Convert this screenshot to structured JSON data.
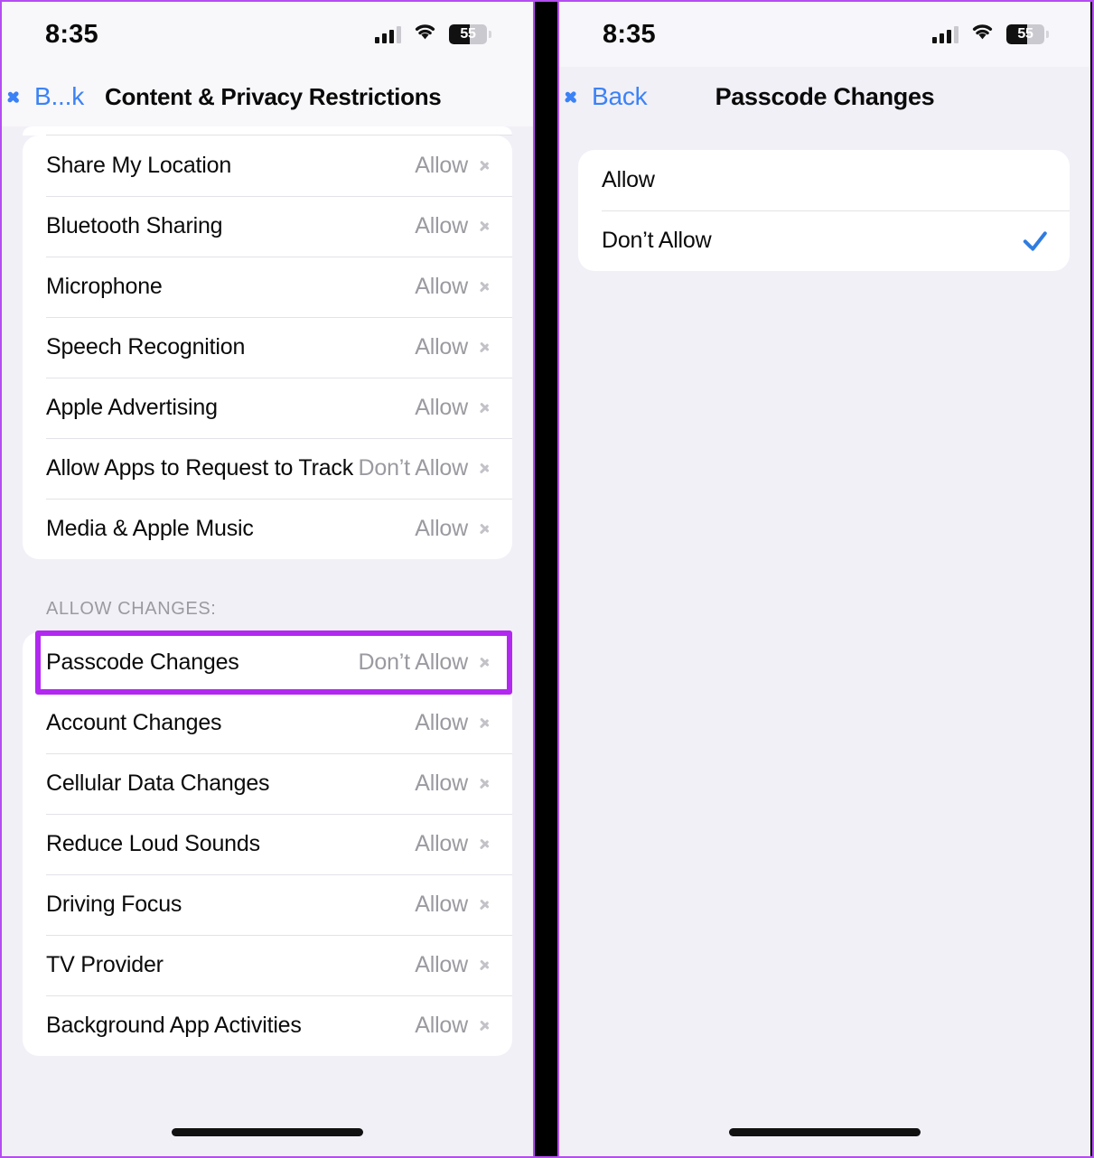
{
  "colors": {
    "accent_purple": "#b228f0",
    "ios_blue": "#3b82f6",
    "check_blue": "#2f7ce0",
    "value_gray": "#9a9aa0",
    "page_bg": "#f2f0f7",
    "card_bg": "#ffffff"
  },
  "left_panel": {
    "status_bar": {
      "time": "8:35",
      "battery_percent": "55",
      "cellular_icon": "cellular-bars-icon",
      "wifi_icon": "wifi-icon",
      "battery_icon": "battery-icon"
    },
    "nav": {
      "back_label": "B...k",
      "back_icon": "chevron-left-icon",
      "title": "Content & Privacy Restrictions"
    },
    "section_1": {
      "rows": [
        {
          "label": "Share My Location",
          "value": "Allow"
        },
        {
          "label": "Bluetooth Sharing",
          "value": "Allow"
        },
        {
          "label": "Microphone",
          "value": "Allow"
        },
        {
          "label": "Speech Recognition",
          "value": "Allow"
        },
        {
          "label": "Apple Advertising",
          "value": "Allow"
        },
        {
          "label": "Allow Apps to Request to Track",
          "value": "Don’t Allow"
        },
        {
          "label": "Media & Apple Music",
          "value": "Allow"
        }
      ]
    },
    "section_2": {
      "header": "ALLOW CHANGES:",
      "rows": [
        {
          "label": "Passcode Changes",
          "value": "Don’t Allow",
          "highlighted": true
        },
        {
          "label": "Account Changes",
          "value": "Allow"
        },
        {
          "label": "Cellular Data Changes",
          "value": "Allow"
        },
        {
          "label": "Reduce Loud Sounds",
          "value": "Allow"
        },
        {
          "label": "Driving Focus",
          "value": "Allow"
        },
        {
          "label": "TV Provider",
          "value": "Allow"
        },
        {
          "label": "Background App Activities",
          "value": "Allow"
        }
      ]
    }
  },
  "right_panel": {
    "status_bar": {
      "time": "8:35",
      "battery_percent": "55",
      "cellular_icon": "cellular-bars-icon",
      "wifi_icon": "wifi-icon",
      "battery_icon": "battery-icon"
    },
    "nav": {
      "back_label": "Back",
      "back_icon": "chevron-left-icon",
      "title": "Passcode Changes"
    },
    "options": [
      {
        "label": "Allow",
        "selected": false
      },
      {
        "label": "Don’t Allow",
        "selected": true
      }
    ]
  }
}
